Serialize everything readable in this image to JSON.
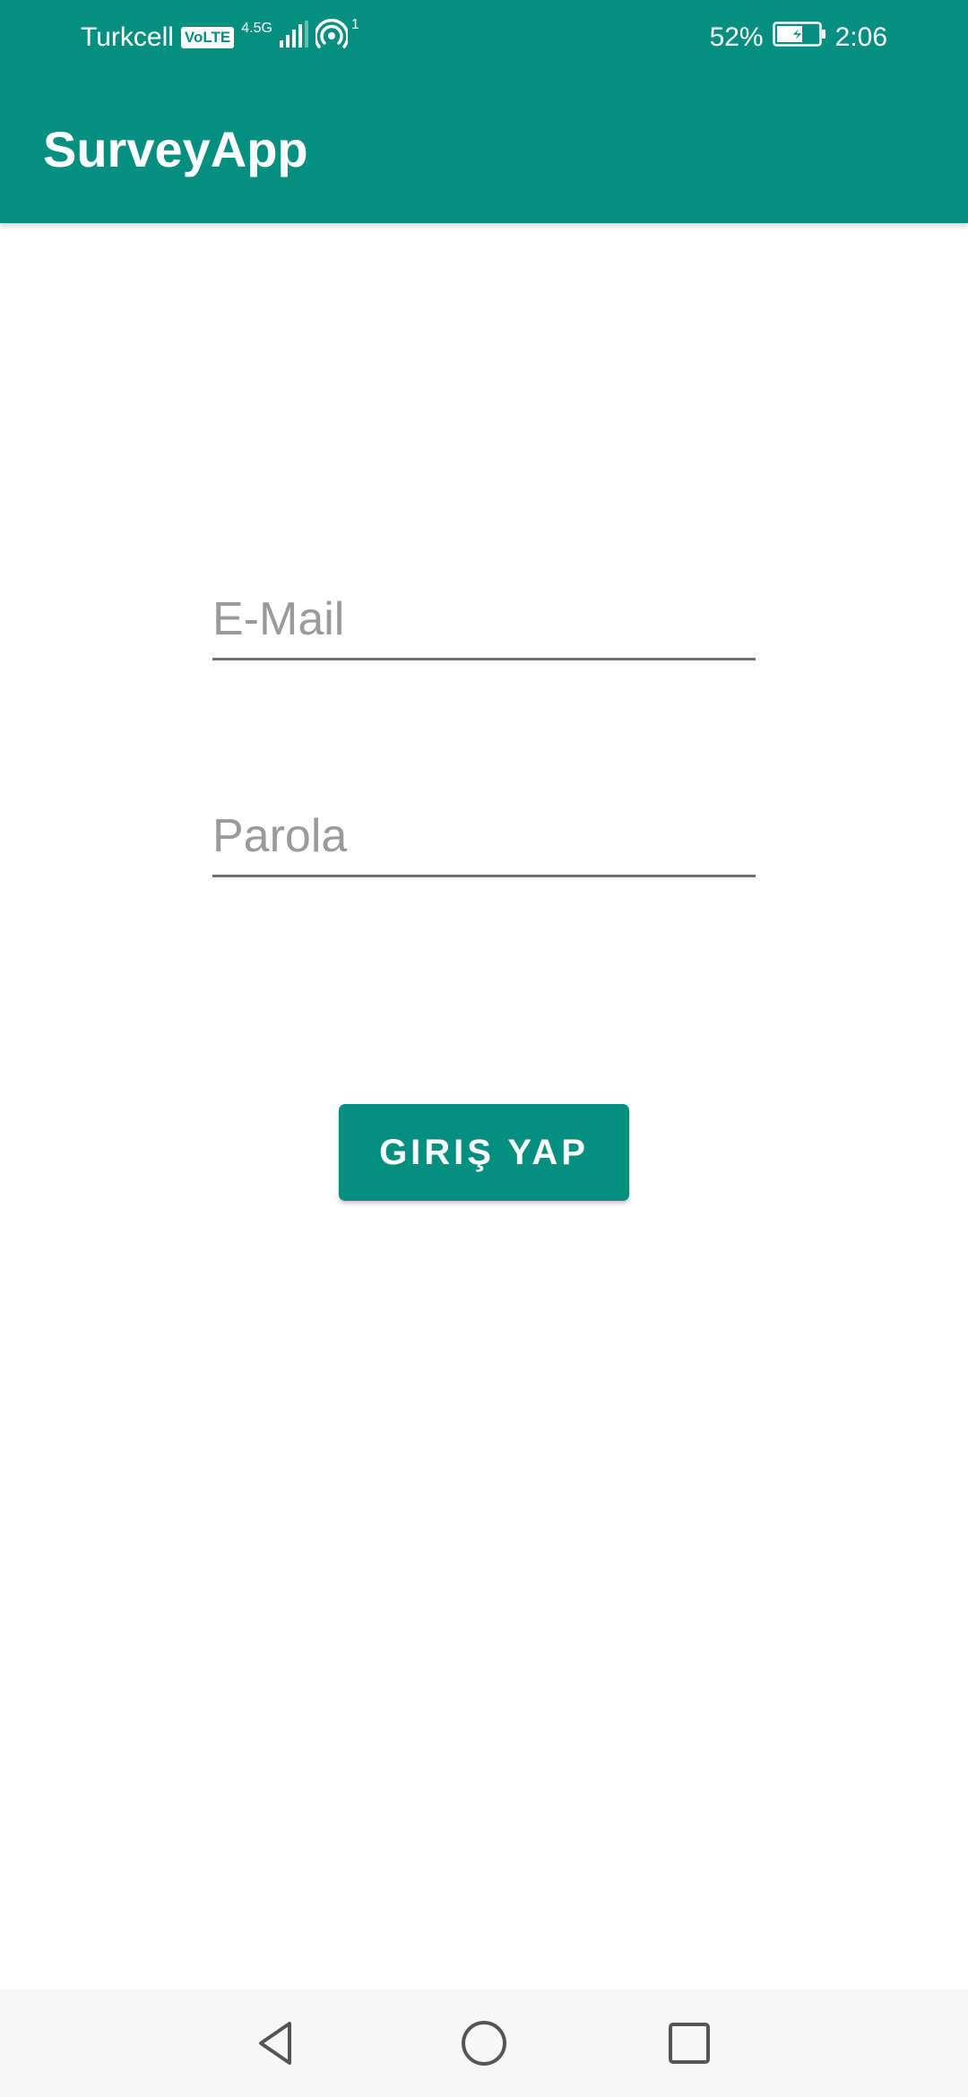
{
  "status_bar": {
    "carrier": "Turkcell",
    "volte": "VoLTE",
    "network": "4.5G",
    "hotspot_count": "1",
    "battery": "52%",
    "time": "2:06"
  },
  "app_bar": {
    "title": "SurveyApp"
  },
  "login_form": {
    "email_placeholder": "E-Mail",
    "email_value": "",
    "password_placeholder": "Parola",
    "password_value": "",
    "submit_label": "GIRIŞ YAP"
  },
  "nav_bar": {
    "back_icon": "back-triangle-icon",
    "home_icon": "home-circle-icon",
    "recents_icon": "recents-square-icon"
  },
  "colors": {
    "primary": "#058F81",
    "background": "#FFFFFF",
    "nav_background": "#F7F7F7",
    "hint_text": "#9A9A9A",
    "underline": "#6F6F6F"
  }
}
